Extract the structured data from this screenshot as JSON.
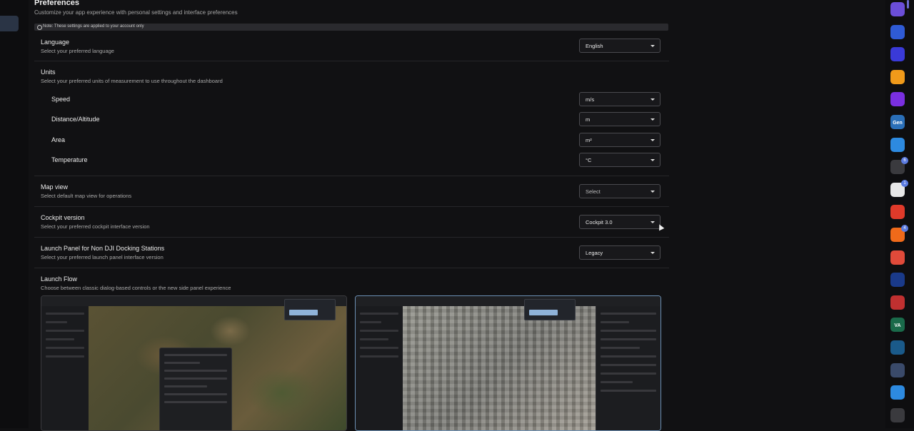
{
  "page": {
    "title": "Preferences",
    "subtitle": "Customize your app experience with personal settings and interface preferences",
    "note": "Note: These settings are applied to your account only"
  },
  "language": {
    "label": "Language",
    "desc": "Select your preferred language",
    "value": "English"
  },
  "units": {
    "label": "Units",
    "desc": "Select your preferred units of measurement to use throughout the dashboard",
    "speed": {
      "label": "Speed",
      "value": "m/s"
    },
    "distance": {
      "label": "Distance/Altitude",
      "value": "m"
    },
    "area": {
      "label": "Area",
      "value": "m²"
    },
    "temperature": {
      "label": "Temperature",
      "value": "°C"
    }
  },
  "map_view": {
    "label": "Map view",
    "desc": "Select default map view for operations",
    "value": "Select"
  },
  "cockpit": {
    "label": "Cockpit version",
    "desc": "Select your preferred cockpit interface version",
    "value": "Cockpit 3.0"
  },
  "launch_panel": {
    "label": "Launch Panel for Non DJI Docking Stations",
    "desc": "Select your preferred launch panel interface version",
    "value": "Legacy"
  },
  "launch_flow": {
    "label": "Launch Flow",
    "desc": "Choose between classic dialog-based controls or the new side panel experience"
  },
  "dock": {
    "icons": [
      {
        "name": "app-purple-icon",
        "color": "#6b4ed8"
      },
      {
        "name": "send-icon",
        "color": "#2f5bd6"
      },
      {
        "name": "drone-blue-icon",
        "color": "#3a3ad8"
      },
      {
        "name": "orange-hex-icon",
        "color": "#f09a1a"
      },
      {
        "name": "purple-ring-icon",
        "color": "#7a2fe0"
      },
      {
        "name": "genesis-icon",
        "color": "#2a6fb8",
        "text": "Gen"
      },
      {
        "name": "diamond-icon",
        "color": "#2d8ae0"
      },
      {
        "name": "grey-grid-icon",
        "color": "#3a3a3e",
        "badge": "6"
      },
      {
        "name": "cone-icon",
        "color": "#e8e8e8",
        "badge": "1"
      },
      {
        "name": "alarm-icon",
        "color": "#e03a2a"
      },
      {
        "name": "flame-icon",
        "color": "#f06a1a",
        "badge": "4"
      },
      {
        "name": "record-icon",
        "color": "#e04a3a"
      },
      {
        "name": "s-logo-icon",
        "color": "#1a3a8a"
      },
      {
        "name": "bar-chart-icon",
        "color": "#c03030"
      },
      {
        "name": "va-icon",
        "color": "#1a6a4a",
        "text": "VA"
      },
      {
        "name": "a-logo-icon",
        "color": "#1a5a8a"
      },
      {
        "name": "globe-icon",
        "color": "#3a4a6a"
      },
      {
        "name": "plane-icon",
        "color": "#2d8ae0"
      },
      {
        "name": "grey-grid-icon-2",
        "color": "#3a3a3e"
      }
    ]
  }
}
